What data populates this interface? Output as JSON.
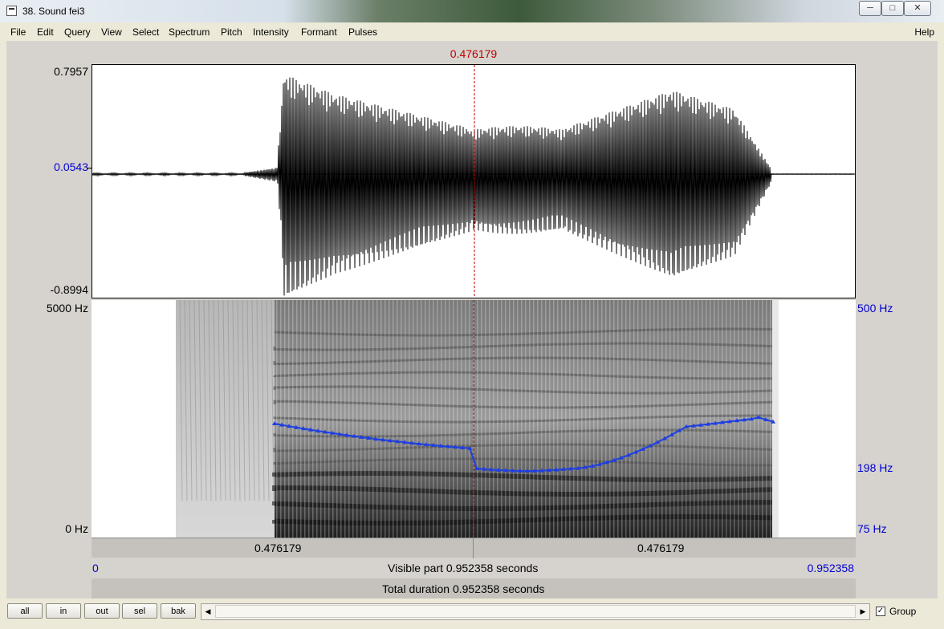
{
  "window": {
    "title": "38. Sound fei3"
  },
  "menu": {
    "items": [
      "File",
      "Edit",
      "Query",
      "View",
      "Select",
      "Spectrum",
      "Pitch",
      "Intensity",
      "Formant",
      "Pulses"
    ],
    "help": "Help"
  },
  "cursor": {
    "time_label": "0.476179",
    "color": "#c00000"
  },
  "waveform": {
    "max_label": "0.7957",
    "mid_label": "0.0543",
    "min_label": "-0.8994"
  },
  "spectrogram": {
    "top_freq_label": "5000 Hz",
    "bottom_freq_label": "0 Hz",
    "pitch_top_label": "500 Hz",
    "pitch_mid_label": "198 Hz",
    "pitch_bottom_label": "75 Hz",
    "pitch_color": "#1f3fe0"
  },
  "timebar": {
    "left_segment": "0.476179",
    "right_segment": "0.476179",
    "start_label": "0",
    "end_label": "0.952358",
    "visible_part": "Visible part 0.952358 seconds",
    "total_duration": "Total duration 0.952358 seconds"
  },
  "buttons": {
    "all": "all",
    "in": "in",
    "out": "out",
    "sel": "sel",
    "bak": "bak"
  },
  "group": {
    "label": "Group",
    "checked": true
  },
  "icons": {
    "minimize": "minimize-icon",
    "maximize": "maximize-icon",
    "close": "close-icon",
    "scroll_left": "chevron-left-icon",
    "scroll_right": "chevron-right-icon"
  }
}
